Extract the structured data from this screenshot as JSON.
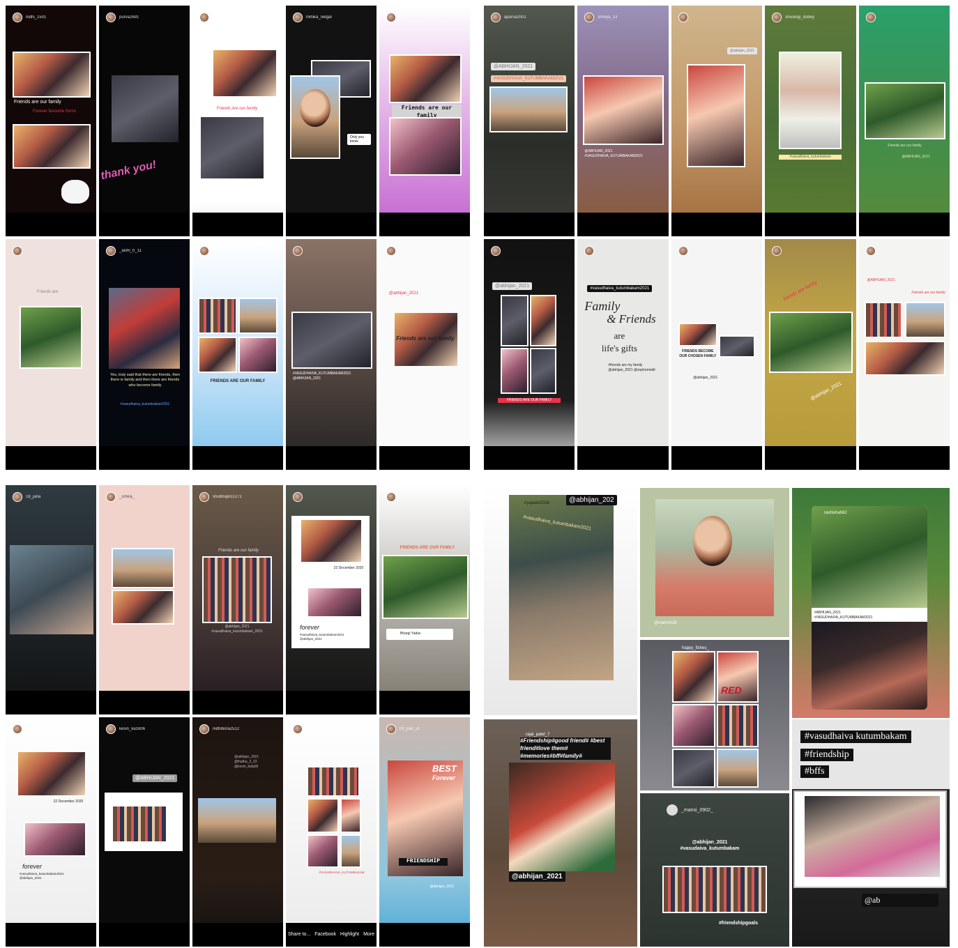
{
  "q1": {
    "row1": [
      {
        "user": "nidhi_1501",
        "caption": "Friends are our family",
        "sub": "Forever favourite forms"
      },
      {
        "user": "purva2691",
        "sticker": "thank you!"
      },
      {
        "user": "",
        "caption": "Friends Are our family"
      },
      {
        "user": "mihika_nelgar",
        "sticker": "Only you know"
      },
      {
        "user": "",
        "caption": "Friends are our family"
      }
    ],
    "row2": [
      {
        "user": "",
        "caption": "Friends are"
      },
      {
        "user": "_aishi_h_11",
        "caption": "Yes, truly said that there are friends, then there is family and then there are friends who become family",
        "sub": "#vasudhaiva_kutumbakam2021"
      },
      {
        "user": "",
        "caption": "FRIENDS ARE OUR FAMILY"
      },
      {
        "user": "",
        "caption": "#VASUDHAIVA_KUTUMBAKAM2021 @ABHIJAN_2021"
      },
      {
        "user": "",
        "caption": "Friends are our family",
        "sub": "@abhijan_2021"
      }
    ]
  },
  "q2": {
    "row1": [
      {
        "user": "apurva2001",
        "tag1": "@ABHIJAN_2021",
        "tag2": "#VASUDHAIVA_KUTUMBAKAM2021"
      },
      {
        "user": "shreya_13",
        "caption": "@ABHIJAN_2021 #VASUDHAIVA_KUTUMBAKAM2021"
      },
      {
        "user": "",
        "caption": "@abhijan_2021"
      },
      {
        "user": "shivangi_dubey",
        "caption": "#vasudhaiva_kutumbakam"
      },
      {
        "user": "",
        "caption": "Friends are our family",
        "sub": "@ABHIJAN_2021"
      }
    ],
    "row2": [
      {
        "user": "",
        "tag1": "@abhijan_2021",
        "caption": "FRIENDS ARE OUR FAMILY"
      },
      {
        "user": "",
        "tag1": "#vasudhaiva_kutumbakam2021",
        "q1": "Family",
        "q2": "& Friends",
        "q3": "are",
        "q4": "life's gifts",
        "caption": "#friends are my family @abhijan_2021 @snphomedit"
      },
      {
        "user": "",
        "caption": "FRIENDS BECOME OUR CHOSEN FAMILY",
        "sub": "@abhijan_2021"
      },
      {
        "user": "",
        "caption": "friends are family",
        "sub": "@abhijan_2021"
      },
      {
        "user": "",
        "caption": "Friends are our family",
        "sub": "@ABHIJAN_2021"
      }
    ]
  },
  "q3": {
    "row1": [
      {
        "user": "18_jana"
      },
      {
        "user": "_ishika_"
      },
      {
        "user": "shubhapro1271",
        "caption": "Friends are our family",
        "sub": "@abhijan_2021 #vasudhaiva_kutumbakam_2021"
      },
      {
        "user": "",
        "caption": "forever",
        "sub": "#vasudhaiva_kutumbakam2021 @abhijan_2021",
        "date": "22 December 2020"
      },
      {
        "user": "",
        "caption": "FRIENDS ARE OUR FAMILY",
        "sub": "Bhargi Yadav"
      }
    ],
    "row2": [
      {
        "user": "",
        "caption": "forever",
        "sub": "#vasudhaiva_kutumbakam2021 @abhijan_2021",
        "date": "22 December 2020"
      },
      {
        "user": "kesin_ka1606",
        "tag1": "@ABHIJAN_2021"
      },
      {
        "user": "nidhibora2512",
        "caption": "@abhijan_2021 @lhathu_2_22 @kevin_kida00"
      },
      {
        "user": "",
        "caption": "#VASUDHAIVA_KUTUMBAKAM",
        "icons": [
          "Share to...",
          "Facebook",
          "Highlight",
          "More"
        ]
      },
      {
        "user": "09_pari_st",
        "sticker1": "BEST",
        "sticker2": "Forever",
        "caption": "FRIENDSHIP",
        "sub": "@abhijan_2021"
      }
    ]
  },
  "q4": {
    "a": {
      "user": "riyapatel2336",
      "tag": "@abhijan_202",
      "caption": "#vasudhaiva_kutumbakam2021"
    },
    "b": {
      "caption": "@mahrsh26"
    },
    "c": {
      "user": "rashishah62",
      "caption": "#ABHIJAN_2021 #VASUDHAIVA_KUTUMBAKAM2021"
    },
    "d": {
      "user": "rajal_patel_7",
      "caption": "#Friendship#good friend# #best friend#love them# #memories#bff#family#",
      "tag": "@abhijan_2021"
    },
    "e": {
      "user": "happy_fishes_",
      "sticker": "RED"
    },
    "f": {
      "hashtags": [
        "#vasudhaiva kutumbakam",
        "#friendship",
        "#bffs"
      ]
    },
    "g": {
      "user": "_mansi_0902_",
      "caption": "@abhijan_2021 #vasudaiva_kutumbakam",
      "sub": "#friendshipgoals"
    },
    "h": {
      "tag": "@ab"
    }
  },
  "colors": {
    "storyBar": "#000000",
    "tagDark": "#111111",
    "accentRed": "#e8334a",
    "accentYellow": "#ffd400"
  }
}
